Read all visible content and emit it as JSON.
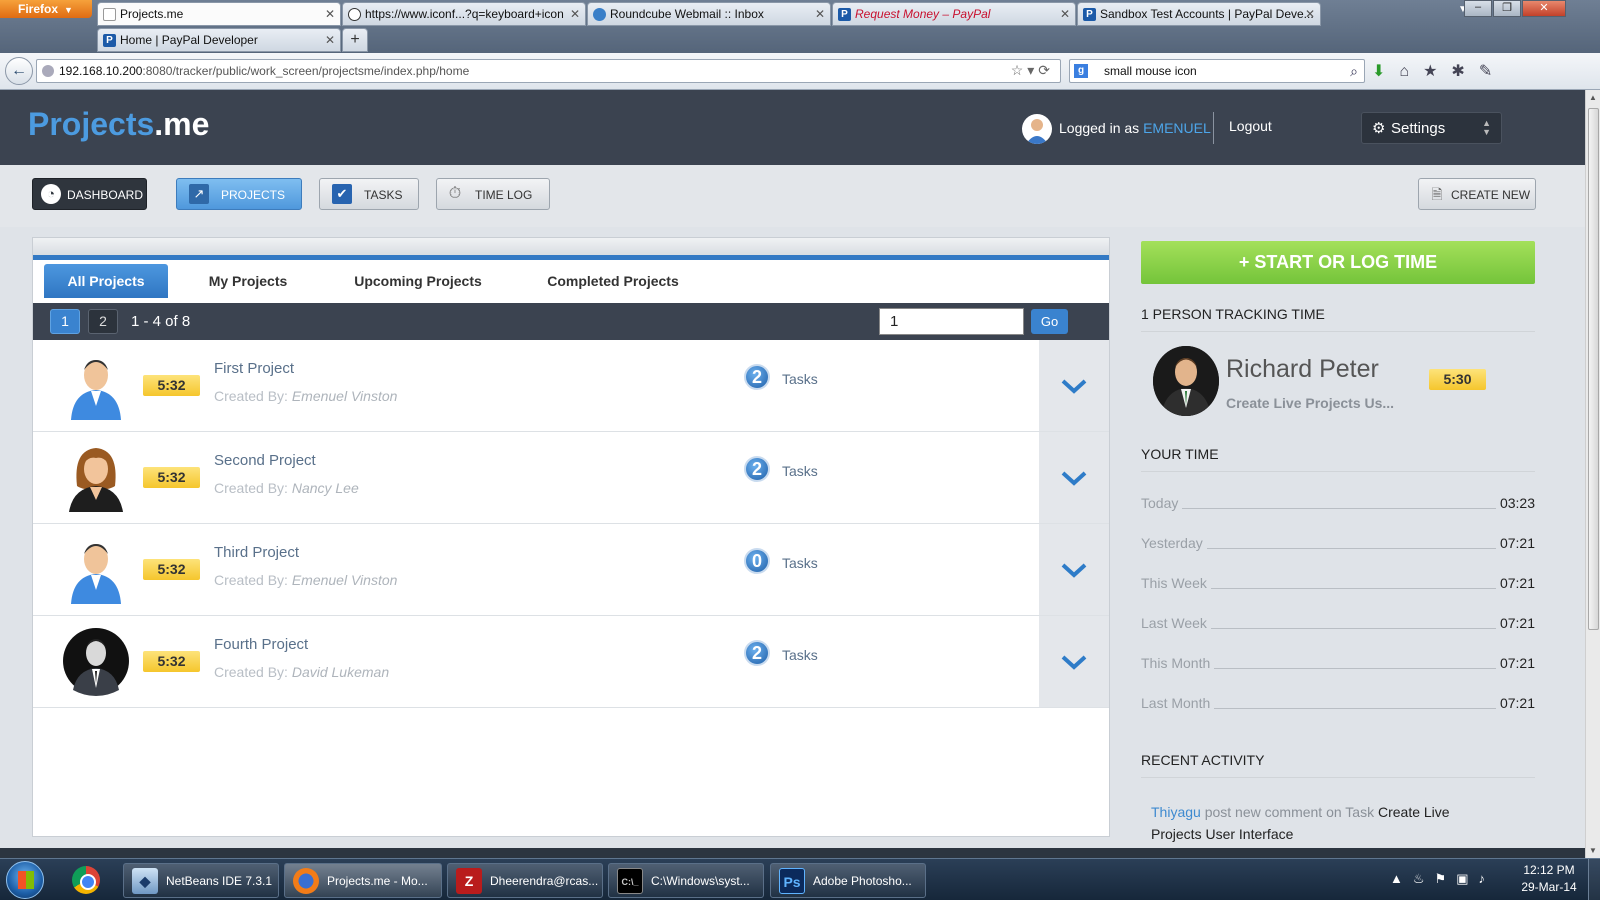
{
  "browser": {
    "menu_label": "Firefox",
    "tabs": [
      {
        "title": "Projects.me",
        "active": true
      },
      {
        "title": "https://www.iconf...?q=keyboard+icon",
        "active": false
      },
      {
        "title": "Roundcube Webmail :: Inbox",
        "active": false
      },
      {
        "title": "Request Money – PayPal",
        "active": false
      },
      {
        "title": "Sandbox Test Accounts | PayPal Deve...",
        "active": false
      },
      {
        "title": "Home | PayPal Developer",
        "active": false
      }
    ],
    "new_tab": "+",
    "url_host": "192.168.10.200",
    "url_rest": ":8080/tracker/public/work_screen/projectsme/index.php/home",
    "search_value": "small mouse icon"
  },
  "app": {
    "logo_main": "Projects",
    "logo_suffix": ".me",
    "logged_in_prefix": "Logged in as",
    "username": "EMENUEL",
    "logout": "Logout",
    "settings": "Settings"
  },
  "nav": {
    "dashboard": "DASHBOARD",
    "projects": "PROJECTS",
    "tasks": "TASKS",
    "timelog": "TIME LOG",
    "create_new": "CREATE NEW"
  },
  "project_tabs": [
    "All Projects",
    "My Projects",
    "Upcoming Projects",
    "Completed Projects"
  ],
  "pager": {
    "pages": [
      "1",
      "2"
    ],
    "current": "1",
    "range_text": "1 - 4 of 8",
    "goto_value": "1",
    "go_label": "Go"
  },
  "projects": [
    {
      "time": "5:32",
      "title": "First Project",
      "created_by_label": "Created By:",
      "creator": "Emenuel Vinston",
      "task_count": "2",
      "tasks_label": "Tasks",
      "avatar": "male-blue-avatar"
    },
    {
      "time": "5:32",
      "title": "Second Project",
      "created_by_label": "Created By:",
      "creator": "Nancy Lee",
      "task_count": "2",
      "tasks_label": "Tasks",
      "avatar": "female-avatar"
    },
    {
      "time": "5:32",
      "title": "Third Project",
      "created_by_label": "Created By:",
      "creator": "Emenuel Vinston",
      "task_count": "0",
      "tasks_label": "Tasks",
      "avatar": "male-blue-avatar"
    },
    {
      "time": "5:32",
      "title": "Fourth Project",
      "created_by_label": "Created By:",
      "creator": "David Lukeman",
      "task_count": "2",
      "tasks_label": "Tasks",
      "avatar": "businessman-avatar"
    }
  ],
  "sidebar": {
    "start_button": "+ START OR LOG TIME",
    "tracking_header": "1 PERSON TRACKING TIME",
    "tracker_name": "Richard Peter",
    "tracker_task": "Create Live Projects Us...",
    "tracker_time": "5:30",
    "your_time_header": "YOUR TIME",
    "time_rows": [
      {
        "label": "Today",
        "value": "03:23"
      },
      {
        "label": "Yesterday",
        "value": "07:21"
      },
      {
        "label": "This Week",
        "value": "07:21"
      },
      {
        "label": "Last Week",
        "value": "07:21"
      },
      {
        "label": "This Month",
        "value": "07:21"
      },
      {
        "label": "Last Month",
        "value": "07:21"
      }
    ],
    "activity_header": "RECENT ACTIVITY",
    "activity": {
      "who": "Thiyagu",
      "action": "post new comment on Task",
      "target": "Create Live Projects User Interface"
    }
  },
  "taskbar": {
    "items": [
      "NetBeans IDE 7.3.1",
      "Projects.me - Mo...",
      "Dheerendra@rcas...",
      "C:\\Windows\\syst...",
      "Adobe Photosho..."
    ],
    "time": "12:12 PM",
    "date": "29-Mar-14"
  },
  "colors": {
    "accent_blue": "#3379c4",
    "header_dark": "#3b4350",
    "badge_yellow": "#f5c62d",
    "start_green": "#74c43a"
  }
}
